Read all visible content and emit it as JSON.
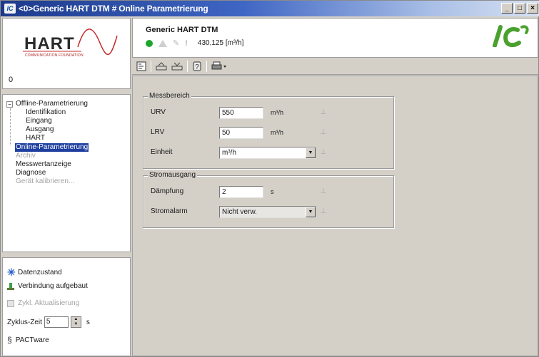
{
  "window": {
    "title": "<0>Generic HART DTM # Online Parametrierung",
    "icon_name": "ics-app-icon",
    "buttons": [
      "_",
      "□",
      "×"
    ]
  },
  "left": {
    "logo_text": "HART",
    "logo_sub": "COMMUNICATION FOUNDATION",
    "device_address": "0",
    "tree": {
      "root": "Offline-Parametrierung",
      "children": [
        "Identifikation",
        "Eingang",
        "Ausgang",
        "HART"
      ],
      "items": [
        "Online-Parametrierung",
        "Archiv",
        "Messwertanzeige",
        "Diagnose",
        "Gerät kalibrieren..."
      ],
      "selected": "Online-Parametrierung"
    },
    "status": {
      "data_state": "Datenzustand",
      "connection": "Verbindung aufgebaut",
      "cyclic_update": "Zykl. Aktualisierung",
      "cycle_time_label": "Zyklus-Zeit",
      "cycle_time_value": "5",
      "cycle_time_unit": "s",
      "pactware": "PACTware"
    }
  },
  "header": {
    "device_title": "Generic HART DTM",
    "pv_value": "430,125 [m³/h]",
    "logo": "ics-logo",
    "accent_color": "#1ea52d"
  },
  "toolbar": {
    "icons": [
      "parameter-view-icon",
      "upload-icon",
      "download-icon",
      "help-icon",
      "print-icon"
    ]
  },
  "messbereich": {
    "title": "Messbereich",
    "urv_label": "URV",
    "urv_value": "550",
    "urv_unit": "m³/h",
    "lrv_label": "LRV",
    "lrv_value": "50",
    "lrv_unit": "m³/h",
    "unit_label": "Einheit",
    "unit_value": "m³/h"
  },
  "stromausgang": {
    "title": "Stromausgang",
    "damping_label": "Dämpfung",
    "damping_value": "2",
    "damping_unit": "s",
    "alarm_label": "Stromalarm",
    "alarm_value": "Nicht verw."
  }
}
